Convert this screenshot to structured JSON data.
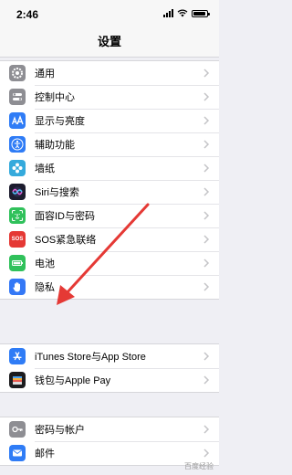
{
  "status_bar": {
    "time": "2:46"
  },
  "header": {
    "title": "设置"
  },
  "groups": [
    {
      "items": [
        {
          "label": "通用",
          "icon": "gear-icon",
          "color": "#8e8e93"
        },
        {
          "label": "控制中心",
          "icon": "toggles-icon",
          "color": "#8e8e93"
        },
        {
          "label": "显示与亮度",
          "icon": "display-aa-icon",
          "color": "#2f7cf6"
        },
        {
          "label": "辅助功能",
          "icon": "accessibility-icon",
          "color": "#2f7cf6"
        },
        {
          "label": "墙纸",
          "icon": "flower-icon",
          "color": "#35aadc"
        },
        {
          "label": "Siri与搜索",
          "icon": "siri-icon",
          "color": "#1c1c2e"
        },
        {
          "label": "面容ID与密码",
          "icon": "face-id-icon",
          "color": "#30c15b"
        },
        {
          "label": "SOS紧急联络",
          "icon": "sos-icon",
          "color": "#e53935"
        },
        {
          "label": "电池",
          "icon": "battery-icon",
          "color": "#30c15b"
        },
        {
          "label": "隐私",
          "icon": "hand-icon",
          "color": "#3478f6"
        }
      ]
    },
    {
      "items": [
        {
          "label": "iTunes Store与App Store",
          "icon": "app-store-icon",
          "color": "#2f7cf6"
        },
        {
          "label": "钱包与Apple Pay",
          "icon": "wallet-icon",
          "color": "#1c1c1e"
        }
      ]
    },
    {
      "items": [
        {
          "label": "密码与帐户",
          "icon": "key-icon",
          "color": "#8e8e93"
        },
        {
          "label": "邮件",
          "icon": "mail-icon",
          "color": "#2f7cf6"
        }
      ]
    }
  ],
  "sos_text": "SOS",
  "watermark": "百度经验",
  "annotation": {
    "color": "#e53935"
  }
}
